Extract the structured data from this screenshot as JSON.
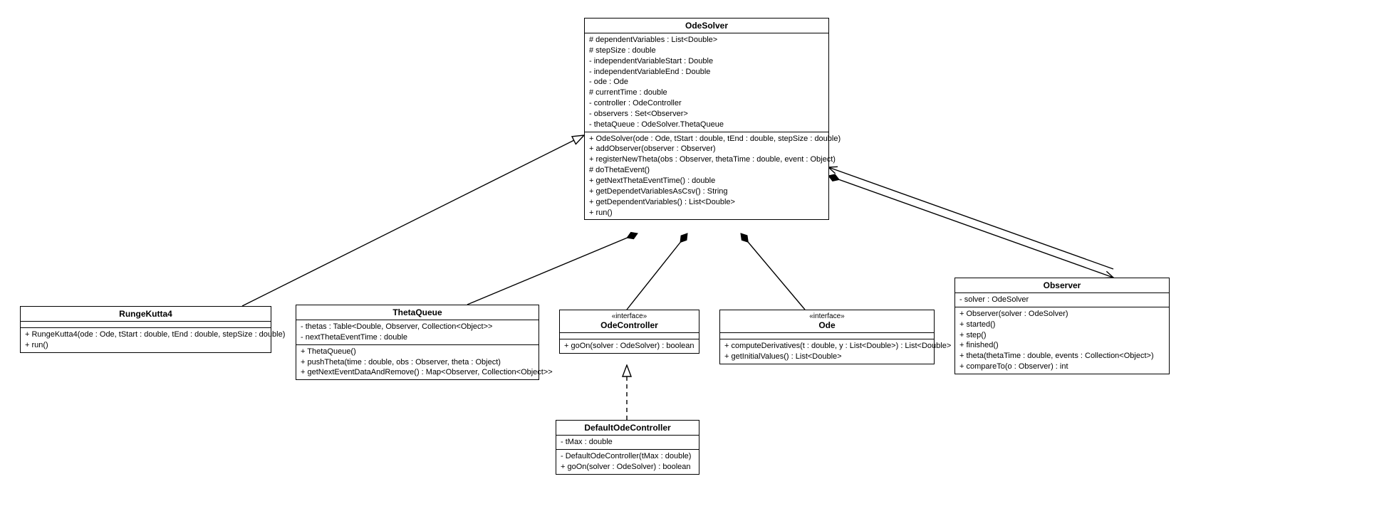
{
  "classes": {
    "OdeSolver": {
      "name": "OdeSolver",
      "attributes": [
        "# dependentVariables : List<Double>",
        "# stepSize : double",
        "- independentVariableStart : Double",
        "- independentVariableEnd : Double",
        "- ode : Ode",
        "# currentTime : double",
        "- controller : OdeController",
        "- observers : Set<Observer>",
        "- thetaQueue : OdeSolver.ThetaQueue"
      ],
      "operations": [
        "+ OdeSolver(ode : Ode, tStart : double, tEnd : double, stepSize : double)",
        "+ addObserver(observer : Observer)",
        "+ registerNewTheta(obs : Observer, thetaTime : double, event : Object)",
        "# doThetaEvent()",
        "+ getNextThetaEventTime() : double",
        "+ getDependetVariablesAsCsv() : String",
        "+ getDependentVariables() : List<Double>",
        "+ run()"
      ]
    },
    "RungeKutta4": {
      "name": "RungeKutta4",
      "attributes": [],
      "operations": [
        "+ RungeKutta4(ode : Ode, tStart : double, tEnd : double, stepSize : double)",
        "+ run()"
      ]
    },
    "ThetaQueue": {
      "name": "ThetaQueue",
      "attributes": [
        "- thetas : Table<Double, Observer, Collection<Object>>",
        "- nextThetaEventTime : double"
      ],
      "operations": [
        "+ ThetaQueue()",
        "+ pushTheta(time : double, obs : Observer, theta : Object)",
        "+ getNextEventDataAndRemove() : Map<Observer, Collection<Object>>"
      ]
    },
    "OdeController": {
      "name": "OdeController",
      "stereotype": "«interface»",
      "attributes": [],
      "operations": [
        "+ goOn(solver : OdeSolver) : boolean"
      ]
    },
    "Ode": {
      "name": "Ode",
      "stereotype": "«interface»",
      "attributes": [],
      "operations": [
        "+ computeDerivatives(t : double, y : List<Double>) : List<Double>",
        "+ getInitialValues() : List<Double>"
      ]
    },
    "Observer": {
      "name": "Observer",
      "attributes": [
        "- solver : OdeSolver"
      ],
      "operations": [
        "+ Observer(solver : OdeSolver)",
        "+ started()",
        "+ step()",
        "+ finished()",
        "+ theta(thetaTime : double, events : Collection<Object>)",
        "+ compareTo(o : Observer) : int"
      ]
    },
    "DefaultOdeController": {
      "name": "DefaultOdeController",
      "attributes": [
        "- tMax : double"
      ],
      "operations": [
        "- DefaultOdeController(tMax : double)",
        "+ goOn(solver : OdeSolver) : boolean"
      ]
    }
  },
  "chart_data": {
    "type": "uml-class-diagram",
    "nodes": [
      "OdeSolver",
      "RungeKutta4",
      "ThetaQueue",
      "OdeController",
      "Ode",
      "Observer",
      "DefaultOdeController"
    ],
    "edges": [
      {
        "from": "RungeKutta4",
        "to": "OdeSolver",
        "kind": "inheritance"
      },
      {
        "from": "OdeSolver",
        "to": "ThetaQueue",
        "kind": "composition"
      },
      {
        "from": "OdeSolver",
        "to": "OdeController",
        "kind": "composition"
      },
      {
        "from": "OdeSolver",
        "to": "Ode",
        "kind": "composition"
      },
      {
        "from": "OdeSolver",
        "to": "Observer",
        "kind": "bidirectional-association"
      },
      {
        "from": "DefaultOdeController",
        "to": "OdeController",
        "kind": "realization"
      }
    ]
  }
}
